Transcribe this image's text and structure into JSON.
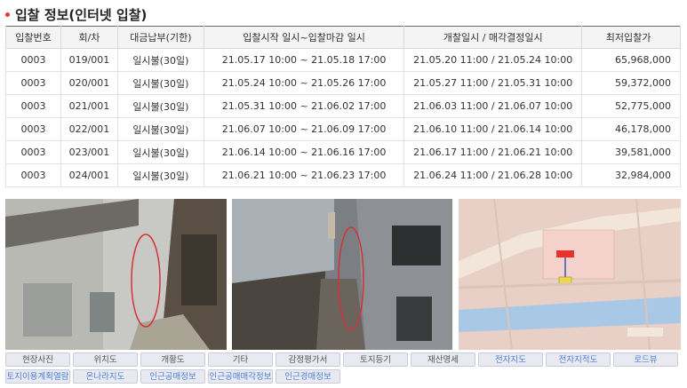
{
  "section": {
    "title": "입찰 정보(인터넷 입찰)"
  },
  "table": {
    "headers": [
      "입찰번호",
      "회/차",
      "대금납부(기한)",
      "입찰시작 일시~입찰마감 일시",
      "개찰일시 / 매각결정일시",
      "최저입찰가"
    ],
    "rows": [
      [
        "0003",
        "019/001",
        "일시불(30일)",
        "21.05.17 10:00 ~ 21.05.18 17:00",
        "21.05.20 11:00 / 21.05.24 10:00",
        "65,968,000"
      ],
      [
        "0003",
        "020/001",
        "일시불(30일)",
        "21.05.24 10:00 ~ 21.05.26 17:00",
        "21.05.27 11:00 / 21.05.31 10:00",
        "59,372,000"
      ],
      [
        "0003",
        "021/001",
        "일시불(30일)",
        "21.05.31 10:00 ~ 21.06.02 17:00",
        "21.06.03 11:00 / 21.06.07 10:00",
        "52,775,000"
      ],
      [
        "0003",
        "022/001",
        "일시불(30일)",
        "21.06.07 10:00 ~ 21.06.09 17:00",
        "21.06.10 11:00 / 21.06.14 10:00",
        "46,178,000"
      ],
      [
        "0003",
        "023/001",
        "일시불(30일)",
        "21.06.14 10:00 ~ 21.06.16 17:00",
        "21.06.17 11:00 / 21.06.21 10:00",
        "39,581,000"
      ],
      [
        "0003",
        "024/001",
        "일시불(30일)",
        "21.06.21 10:00 ~ 21.06.23 17:00",
        "21.06.24 11:00 / 21.06.28 10:00",
        "32,984,000"
      ]
    ]
  },
  "tabs": {
    "row1": [
      {
        "label": "현장사진",
        "highlight": false
      },
      {
        "label": "위치도",
        "highlight": false
      },
      {
        "label": "개황도",
        "highlight": false
      },
      {
        "label": "기타",
        "highlight": false
      },
      {
        "label": "감정평가서",
        "highlight": false
      },
      {
        "label": "토지등기",
        "highlight": false
      },
      {
        "label": "재산명세",
        "highlight": false
      },
      {
        "label": "전자지도",
        "highlight": true
      },
      {
        "label": "전자지적도",
        "highlight": true
      },
      {
        "label": "로드뷰",
        "highlight": true
      }
    ],
    "row2": [
      {
        "label": "토지이용계획열람",
        "highlight": true
      },
      {
        "label": "온나라지도",
        "highlight": true
      },
      {
        "label": "인근공매정보",
        "highlight": true
      },
      {
        "label": "인근공매매각정보",
        "highlight": true
      },
      {
        "label": "인근경매정보",
        "highlight": true
      }
    ]
  },
  "colors": {
    "bullet": "#e8383d",
    "tab_link": "#4a7fd6",
    "header_bg": "#f4f4f4"
  }
}
